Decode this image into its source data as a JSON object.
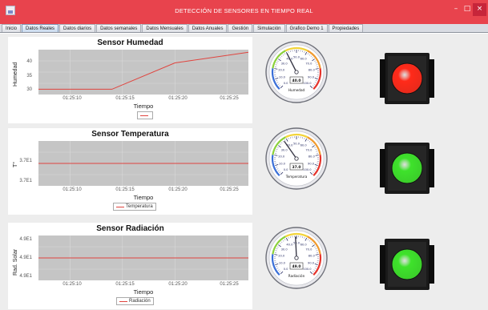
{
  "window": {
    "title": "DETECCIÓN DE SENSORES EN TIEMPO REAL",
    "minimize_glyph": "–",
    "maximize_glyph": "□",
    "close_glyph": "×"
  },
  "tabs": [
    {
      "label": "Inicio",
      "active": false
    },
    {
      "label": "Datos Reales",
      "active": true
    },
    {
      "label": "Datos diarios",
      "active": false
    },
    {
      "label": "Datos semanales",
      "active": false
    },
    {
      "label": "Datos Mensuales",
      "active": false
    },
    {
      "label": "Datos Anuales",
      "active": false
    },
    {
      "label": "Gestión",
      "active": false
    },
    {
      "label": "Simulación",
      "active": false
    },
    {
      "label": "Grafico Demo 1",
      "active": false
    },
    {
      "label": "Propiedades",
      "active": false
    }
  ],
  "colors": {
    "titlebar": "#e8434d",
    "series_line": "#e0443e",
    "light_red": "#ff2a1a",
    "light_green": "#3ee22b"
  },
  "sensors": [
    {
      "id": "humedad",
      "chart_title": "Sensor Humedad",
      "ylabel": "Humedad",
      "xlabel": "Tiempo",
      "legend": "",
      "yticks": [
        "40",
        "35",
        "30"
      ],
      "xticks": [
        "01:25:10",
        "01:25:15",
        "01:25:20",
        "01:25:25"
      ],
      "gauge_label": "Humedad",
      "gauge_value": "40.0",
      "light_state": "red",
      "light_icon": "red-light-icon"
    },
    {
      "id": "temperatura",
      "chart_title": "Sensor Temperatura",
      "ylabel": "T°",
      "xlabel": "Tiempo",
      "legend": "Temperatura",
      "yticks": [
        "3.7E1",
        "3.7E1"
      ],
      "xticks": [
        "01:25:10",
        "01:25:15",
        "01:25:20",
        "01:25:25"
      ],
      "gauge_label": "Temperatura",
      "gauge_value": "37.0",
      "light_state": "green",
      "light_icon": "green-light-icon"
    },
    {
      "id": "radiacion",
      "chart_title": "Sensor Radiación",
      "ylabel": "Rad. Solar",
      "xlabel": "Tiempo",
      "legend": "Radiación",
      "yticks": [
        "4.9E1",
        "4.9E1",
        "4.9E1"
      ],
      "xticks": [
        "01:25:10",
        "01:25:15",
        "01:25:20",
        "01:25:25"
      ],
      "gauge_label": "Radiación",
      "gauge_value": "49.0",
      "light_state": "green",
      "light_icon": "green-light-icon"
    }
  ],
  "gauge": {
    "min": 0,
    "max": 100,
    "tick_labels": [
      "0.0",
      "10.0",
      "20.0",
      "30.0",
      "40.0",
      "50.0",
      "60.0",
      "70.0",
      "80.0",
      "90.0",
      "100.0"
    ]
  },
  "chart_data": [
    {
      "type": "line",
      "title": "Sensor Humedad",
      "xlabel": "Tiempo",
      "ylabel": "Humedad",
      "x": [
        "01:25:07",
        "01:25:14",
        "01:25:20",
        "01:25:27"
      ],
      "series": [
        {
          "values": [
            29,
            29,
            39,
            43
          ]
        }
      ],
      "ylim": [
        27,
        44
      ],
      "xticks": [
        "01:25:10",
        "01:25:15",
        "01:25:20",
        "01:25:25"
      ],
      "grid": true,
      "legend": "bottom-center"
    },
    {
      "type": "line",
      "title": "Sensor Temperatura",
      "xlabel": "Tiempo",
      "ylabel": "T°",
      "x": [
        "01:25:07",
        "01:25:27"
      ],
      "series": [
        {
          "name": "Temperatura",
          "values": [
            37,
            37
          ]
        }
      ],
      "ylim": [
        36.8,
        37.2
      ],
      "xticks": [
        "01:25:10",
        "01:25:15",
        "01:25:20",
        "01:25:25"
      ],
      "grid": true,
      "legend": "bottom-center"
    },
    {
      "type": "line",
      "title": "Sensor Radiación",
      "xlabel": "Tiempo",
      "ylabel": "Rad. Solar",
      "x": [
        "01:25:07",
        "01:25:27"
      ],
      "series": [
        {
          "name": "Radiación",
          "values": [
            49,
            49
          ]
        }
      ],
      "ylim": [
        48.8,
        49.2
      ],
      "xticks": [
        "01:25:10",
        "01:25:15",
        "01:25:20",
        "01:25:25"
      ],
      "grid": true,
      "legend": "bottom-center"
    }
  ]
}
